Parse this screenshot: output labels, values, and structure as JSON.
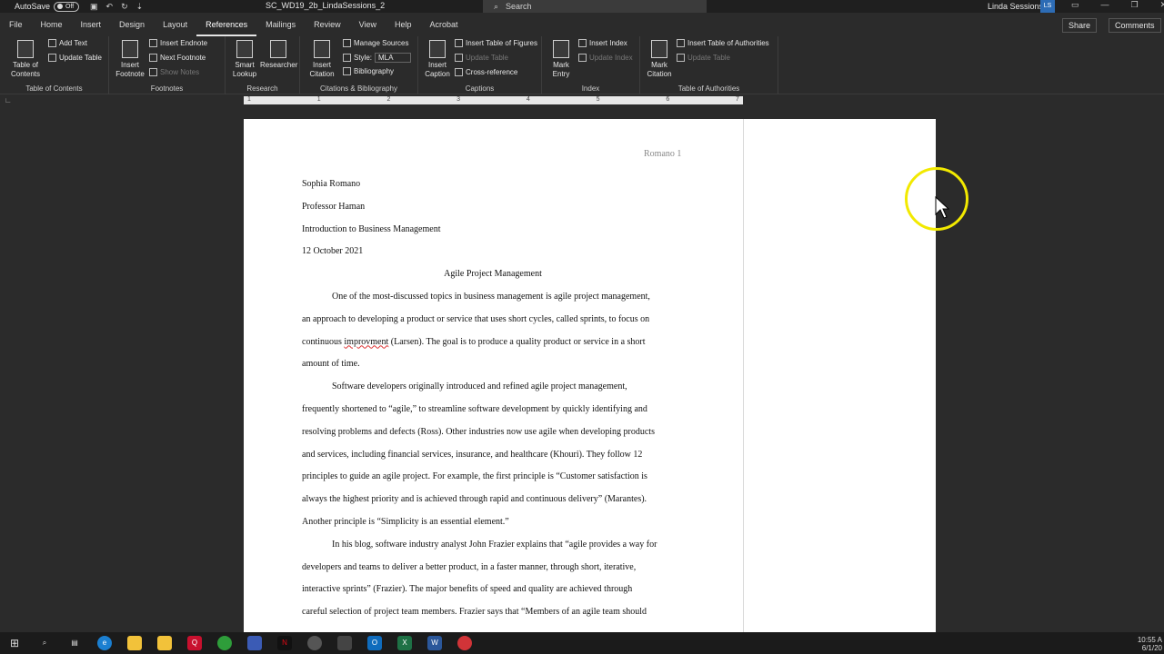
{
  "titlebar": {
    "autosave_label": "AutoSave",
    "autosave_state": "Off",
    "doc_title": "SC_WD19_2b_LindaSessions_2",
    "search_placeholder": "Search",
    "user_name": "Linda Sessions",
    "user_initials": "LS"
  },
  "menu": {
    "tabs": [
      "File",
      "Home",
      "Insert",
      "Design",
      "Layout",
      "References",
      "Mailings",
      "Review",
      "View",
      "Help",
      "Acrobat"
    ],
    "active_tab": "References",
    "share_label": "Share",
    "comments_label": "Comments"
  },
  "ribbon": {
    "toc": {
      "big_label": "Table of Contents",
      "add_text": "Add Text",
      "update_table": "Update Table",
      "group": "Table of Contents"
    },
    "footnotes": {
      "big_label": "Insert Footnote",
      "insert_endnote": "Insert Endnote",
      "next_footnote": "Next Footnote",
      "show_notes": "Show Notes",
      "group": "Footnotes"
    },
    "research": {
      "smart_lookup": "Smart Lookup",
      "researcher": "Researcher",
      "group": "Research"
    },
    "citations": {
      "big_label": "Insert Citation",
      "manage_sources": "Manage Sources",
      "style_label": "Style:",
      "style_value": "MLA",
      "bibliography": "Bibliography",
      "group": "Citations & Bibliography"
    },
    "captions": {
      "big_label": "Insert Caption",
      "insert_table_figures": "Insert Table of Figures",
      "update_table": "Update Table",
      "cross_reference": "Cross-reference",
      "group": "Captions"
    },
    "index": {
      "big_label": "Mark Entry",
      "insert_index": "Insert Index",
      "update_index": "Update Index",
      "group": "Index"
    },
    "authorities": {
      "big_label": "Mark Citation",
      "insert_toa": "Insert Table of Authorities",
      "update_table": "Update Table",
      "group": "Table of Authorities"
    }
  },
  "ruler": {
    "ticks": [
      "1",
      "1",
      "2",
      "3",
      "4",
      "5",
      "6",
      "7"
    ]
  },
  "document": {
    "header": "Romano 1",
    "lines": [
      {
        "text": "Sophia Romano",
        "style": ""
      },
      {
        "text": "Professor Haman",
        "style": ""
      },
      {
        "text": "Introduction to Business Management",
        "style": ""
      },
      {
        "text": "12 October 2021",
        "style": ""
      },
      {
        "text": "Agile Project Management",
        "style": "center"
      },
      {
        "text": "One of the most-discussed topics in business management is agile project management,",
        "style": "indent"
      },
      {
        "text": "an approach to developing a product or service that uses short cycles, called sprints, to focus on",
        "style": ""
      },
      {
        "text": "continuous improvment (Larsen). The goal is to produce a quality product or service in a short",
        "style": ""
      },
      {
        "text": "amount of time.",
        "style": ""
      },
      {
        "text": "Software developers originally introduced and refined agile project management,",
        "style": "indent"
      },
      {
        "text": "frequently shortened to “agile,” to streamline software development by quickly identifying and",
        "style": ""
      },
      {
        "text": "resolving problems and defects (Ross). Other industries now use agile when developing products",
        "style": ""
      },
      {
        "text": "and services, including financial services, insurance, and healthcare (Khouri). They follow 12",
        "style": ""
      },
      {
        "text": "principles to guide an agile project. For example, the first principle is “Customer satisfaction is",
        "style": ""
      },
      {
        "text": "always the highest priority and is achieved through rapid and continuous delivery” (Marantes).",
        "style": ""
      },
      {
        "text": "Another principle is “Simplicity is an essential element.”",
        "style": ""
      },
      {
        "text": "In his blog, software industry analyst John Frazier explains that “agile provides a way for",
        "style": "indent"
      },
      {
        "text": "developers and teams to deliver a better product, in a faster manner, through short, iterative,",
        "style": ""
      },
      {
        "text": "interactive sprints” (Frazier). The major benefits of speed and quality are achieved through",
        "style": ""
      },
      {
        "text": "careful selection of project team members. Frazier says that “Members of an agile team should",
        "style": ""
      }
    ]
  },
  "taskbar": {
    "clock_time": "10:55 A",
    "clock_date": "6/1/20"
  }
}
